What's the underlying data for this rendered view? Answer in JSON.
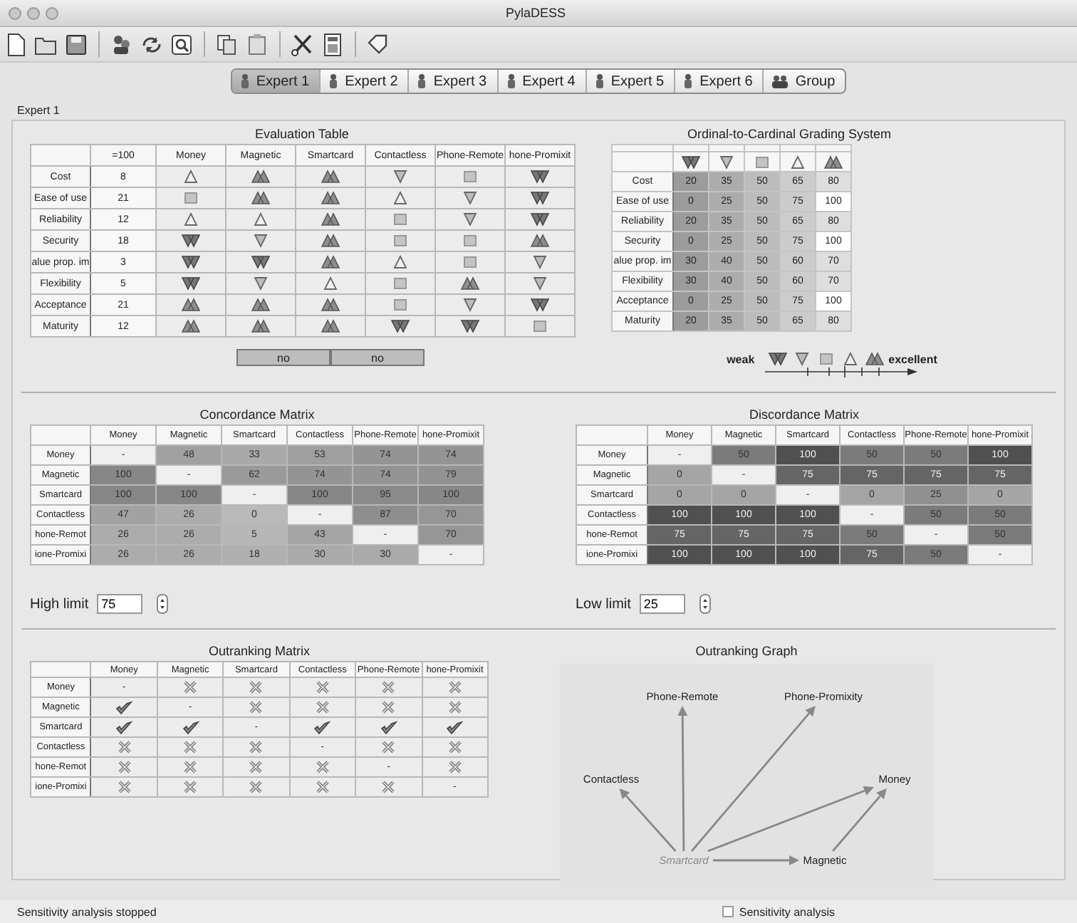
{
  "window": {
    "title": "PylaDESS"
  },
  "toolbar": [
    {
      "kind": "new"
    },
    {
      "kind": "open"
    },
    {
      "kind": "save"
    },
    {
      "kind": "separator"
    },
    {
      "kind": "people"
    },
    {
      "kind": "cycle"
    },
    {
      "kind": "zoom"
    },
    {
      "kind": "separator"
    },
    {
      "kind": "copy"
    },
    {
      "kind": "paste"
    },
    {
      "kind": "separator"
    },
    {
      "kind": "tools"
    },
    {
      "kind": "calculator"
    },
    {
      "kind": "separator"
    },
    {
      "kind": "tag"
    }
  ],
  "tabs": [
    {
      "label": "Expert 1",
      "kind": "expert",
      "selected": true
    },
    {
      "label": "Expert 2",
      "kind": "expert",
      "selected": false
    },
    {
      "label": "Expert 3",
      "kind": "expert",
      "selected": false
    },
    {
      "label": "Expert 4",
      "kind": "expert",
      "selected": false
    },
    {
      "label": "Expert 5",
      "kind": "expert",
      "selected": false
    },
    {
      "label": "Expert 6",
      "kind": "expert",
      "selected": false
    },
    {
      "label": "Group",
      "kind": "group",
      "selected": false
    }
  ],
  "panel_label": "Expert 1",
  "evaluation_table": {
    "title": "Evaluation Table",
    "weight_header": "=100",
    "columns": [
      "Money",
      "Magnetic",
      "Smartcard",
      "Contactless",
      "Phone-Remote",
      "hone-Promixit"
    ],
    "rows": [
      {
        "criterion": "Cost",
        "weight": "8",
        "grades": [
          {
            "kind": "good"
          },
          {
            "kind": "excellent"
          },
          {
            "kind": "excellent"
          },
          {
            "kind": "weak"
          },
          {
            "kind": "neutral"
          },
          {
            "kind": "very_weak"
          }
        ]
      },
      {
        "criterion": "Ease of use",
        "weight": "21",
        "grades": [
          {
            "kind": "neutral"
          },
          {
            "kind": "excellent"
          },
          {
            "kind": "excellent"
          },
          {
            "kind": "good"
          },
          {
            "kind": "weak"
          },
          {
            "kind": "very_weak"
          }
        ]
      },
      {
        "criterion": "Reliability",
        "weight": "12",
        "grades": [
          {
            "kind": "good"
          },
          {
            "kind": "good"
          },
          {
            "kind": "excellent"
          },
          {
            "kind": "neutral"
          },
          {
            "kind": "weak"
          },
          {
            "kind": "very_weak"
          }
        ]
      },
      {
        "criterion": "Security",
        "weight": "18",
        "grades": [
          {
            "kind": "very_weak"
          },
          {
            "kind": "weak"
          },
          {
            "kind": "excellent"
          },
          {
            "kind": "neutral"
          },
          {
            "kind": "neutral"
          },
          {
            "kind": "excellent"
          }
        ]
      },
      {
        "criterion": "alue prop. im",
        "weight": "3",
        "grades": [
          {
            "kind": "very_weak"
          },
          {
            "kind": "very_weak"
          },
          {
            "kind": "excellent"
          },
          {
            "kind": "good"
          },
          {
            "kind": "neutral"
          },
          {
            "kind": "weak"
          }
        ]
      },
      {
        "criterion": "Flexibility",
        "weight": "5",
        "grades": [
          {
            "kind": "very_weak"
          },
          {
            "kind": "weak"
          },
          {
            "kind": "good"
          },
          {
            "kind": "neutral"
          },
          {
            "kind": "excellent"
          },
          {
            "kind": "weak"
          }
        ]
      },
      {
        "criterion": "Acceptance",
        "weight": "21",
        "grades": [
          {
            "kind": "excellent"
          },
          {
            "kind": "excellent"
          },
          {
            "kind": "excellent"
          },
          {
            "kind": "neutral"
          },
          {
            "kind": "weak"
          },
          {
            "kind": "very_weak"
          }
        ]
      },
      {
        "criterion": "Maturity",
        "weight": "12",
        "grades": [
          {
            "kind": "excellent"
          },
          {
            "kind": "excellent"
          },
          {
            "kind": "excellent"
          },
          {
            "kind": "very_weak"
          },
          {
            "kind": "very_weak"
          },
          {
            "kind": "neutral"
          }
        ]
      }
    ]
  },
  "buttons": [
    {
      "label": "no"
    },
    {
      "label": "no"
    }
  ],
  "grading_system": {
    "title": "Ordinal-to-Cardinal Grading System",
    "grades": [
      {
        "kind": "very_weak"
      },
      {
        "kind": "weak"
      },
      {
        "kind": "neutral"
      },
      {
        "kind": "good"
      },
      {
        "kind": "excellent"
      }
    ],
    "rows": [
      {
        "criterion": "Cost",
        "values": [
          "20",
          "35",
          "50",
          "65",
          "80"
        ]
      },
      {
        "criterion": "Ease of use",
        "values": [
          "0",
          "25",
          "50",
          "75",
          "100"
        ]
      },
      {
        "criterion": "Reliability",
        "values": [
          "20",
          "35",
          "50",
          "65",
          "80"
        ]
      },
      {
        "criterion": "Security",
        "values": [
          "0",
          "25",
          "50",
          "75",
          "100"
        ]
      },
      {
        "criterion": "alue prop. im",
        "values": [
          "30",
          "40",
          "50",
          "60",
          "70"
        ]
      },
      {
        "criterion": "Flexibility",
        "values": [
          "30",
          "40",
          "50",
          "60",
          "70"
        ]
      },
      {
        "criterion": "Acceptance",
        "values": [
          "0",
          "25",
          "50",
          "75",
          "100"
        ]
      },
      {
        "criterion": "Maturity",
        "values": [
          "20",
          "35",
          "50",
          "65",
          "80"
        ]
      }
    ]
  },
  "legend": {
    "low": "weak",
    "high": "excellent",
    "grades": [
      {
        "kind": "very_weak"
      },
      {
        "kind": "weak"
      },
      {
        "kind": "neutral"
      },
      {
        "kind": "good"
      },
      {
        "kind": "excellent"
      }
    ]
  },
  "concordance": {
    "kind": "concordance",
    "title": "Concordance Matrix",
    "columns": [
      "Money",
      "Magnetic",
      "Smartcard",
      "Contactless",
      "Phone-Remote",
      "hone-Promixit"
    ],
    "rows": [
      {
        "label": "Money",
        "values": [
          "-",
          "48",
          "33",
          "53",
          "74",
          "74"
        ]
      },
      {
        "label": "Magnetic",
        "values": [
          "100",
          "-",
          "62",
          "74",
          "74",
          "79"
        ]
      },
      {
        "label": "Smartcard",
        "values": [
          "100",
          "100",
          "-",
          "100",
          "95",
          "100"
        ]
      },
      {
        "label": "Contactless",
        "values": [
          "47",
          "26",
          "0",
          "-",
          "87",
          "70"
        ]
      },
      {
        "label": "hone-Remot",
        "values": [
          "26",
          "26",
          "5",
          "43",
          "-",
          "70"
        ]
      },
      {
        "label": "ione-Promixi",
        "values": [
          "26",
          "26",
          "18",
          "30",
          "30",
          "-"
        ]
      }
    ],
    "limit_label": "High limit",
    "limit": "75"
  },
  "discordance": {
    "kind": "discordance",
    "title": "Discordance Matrix",
    "columns": [
      "Money",
      "Magnetic",
      "Smartcard",
      "Contactless",
      "Phone-Remote",
      "hone-Promixit"
    ],
    "rows": [
      {
        "label": "Money",
        "values": [
          "-",
          "50",
          "100",
          "50",
          "50",
          "100"
        ]
      },
      {
        "label": "Magnetic",
        "values": [
          "0",
          "-",
          "75",
          "75",
          "75",
          "75"
        ]
      },
      {
        "label": "Smartcard",
        "values": [
          "0",
          "0",
          "-",
          "0",
          "25",
          "0"
        ]
      },
      {
        "label": "Contactless",
        "values": [
          "100",
          "100",
          "100",
          "-",
          "50",
          "50"
        ]
      },
      {
        "label": "hone-Remot",
        "values": [
          "75",
          "75",
          "75",
          "50",
          "-",
          "50"
        ]
      },
      {
        "label": "ione-Promixi",
        "values": [
          "100",
          "100",
          "100",
          "75",
          "50",
          "-"
        ]
      }
    ],
    "limit_label": "Low limit",
    "limit": "25"
  },
  "outranking_matrix": {
    "title": "Outranking Matrix",
    "columns": [
      "Money",
      "Magnetic",
      "Smartcard",
      "Contactless",
      "Phone-Remote",
      "hone-Promixit"
    ],
    "rows": [
      {
        "label": "Money",
        "cells": [
          {
            "kind": "self",
            "text": "-"
          },
          {
            "kind": "mark",
            "outranks": false
          },
          {
            "kind": "mark",
            "outranks": false
          },
          {
            "kind": "mark",
            "outranks": false
          },
          {
            "kind": "mark",
            "outranks": false
          },
          {
            "kind": "mark",
            "outranks": false
          }
        ]
      },
      {
        "label": "Magnetic",
        "cells": [
          {
            "kind": "mark",
            "outranks": true
          },
          {
            "kind": "self",
            "text": "-"
          },
          {
            "kind": "mark",
            "outranks": false
          },
          {
            "kind": "mark",
            "outranks": false
          },
          {
            "kind": "mark",
            "outranks": false
          },
          {
            "kind": "mark",
            "outranks": false
          }
        ]
      },
      {
        "label": "Smartcard",
        "cells": [
          {
            "kind": "mark",
            "outranks": true
          },
          {
            "kind": "mark",
            "outranks": true
          },
          {
            "kind": "self",
            "text": "-"
          },
          {
            "kind": "mark",
            "outranks": true
          },
          {
            "kind": "mark",
            "outranks": true
          },
          {
            "kind": "mark",
            "outranks": true
          }
        ]
      },
      {
        "label": "Contactless",
        "cells": [
          {
            "kind": "mark",
            "outranks": false
          },
          {
            "kind": "mark",
            "outranks": false
          },
          {
            "kind": "mark",
            "outranks": false
          },
          {
            "kind": "self",
            "text": "-"
          },
          {
            "kind": "mark",
            "outranks": false
          },
          {
            "kind": "mark",
            "outranks": false
          }
        ]
      },
      {
        "label": "hone-Remot",
        "cells": [
          {
            "kind": "mark",
            "outranks": false
          },
          {
            "kind": "mark",
            "outranks": false
          },
          {
            "kind": "mark",
            "outranks": false
          },
          {
            "kind": "mark",
            "outranks": false
          },
          {
            "kind": "self",
            "text": "-"
          },
          {
            "kind": "mark",
            "outranks": false
          }
        ]
      },
      {
        "label": "ione-Promixi",
        "cells": [
          {
            "kind": "mark",
            "outranks": false
          },
          {
            "kind": "mark",
            "outranks": false
          },
          {
            "kind": "mark",
            "outranks": false
          },
          {
            "kind": "mark",
            "outranks": false
          },
          {
            "kind": "mark",
            "outranks": false
          },
          {
            "kind": "self",
            "text": "-"
          }
        ]
      }
    ]
  },
  "outranking_graph": {
    "title": "Outranking Graph",
    "nodes": [
      {
        "label": "Phone-Remote",
        "highlighted": false
      },
      {
        "label": "Phone-Promixity",
        "highlighted": false
      },
      {
        "label": "Contactless",
        "highlighted": false
      },
      {
        "label": "Money",
        "highlighted": false
      },
      {
        "label": "Smartcard",
        "highlighted": true,
        "arrows": [
          {
            "kind": "up_left"
          },
          {
            "kind": "up"
          },
          {
            "kind": "up_right"
          },
          {
            "kind": "right_up"
          },
          {
            "kind": "right"
          }
        ]
      },
      {
        "label": "Magnetic",
        "highlighted": false,
        "arrows": [
          {
            "kind": "up_right"
          }
        ]
      }
    ]
  },
  "status_bar": {
    "message": "Sensitivity analysis stopped",
    "checkbox": {
      "label": "Sensitivity analysis",
      "checked": false
    }
  }
}
